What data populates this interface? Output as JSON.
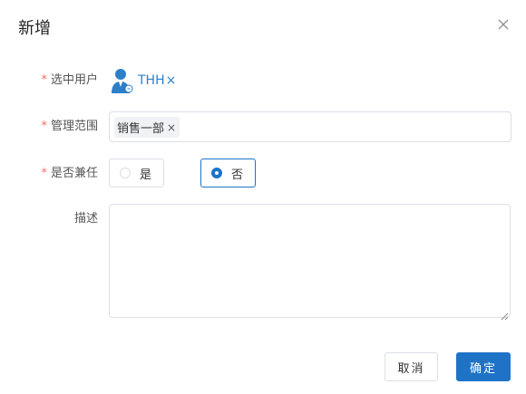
{
  "dialog": {
    "title": "新增"
  },
  "form": {
    "required_mark": "*",
    "selected_user": {
      "label": "选中用户",
      "value": "THH",
      "remove": "×"
    },
    "scope": {
      "label": "管理范围",
      "chips": [
        {
          "text": "销售一部",
          "remove": "×"
        }
      ]
    },
    "concurrent": {
      "label": "是否兼任",
      "options": [
        "是",
        "否"
      ],
      "selected": "否"
    },
    "description": {
      "label": "描述",
      "value": ""
    }
  },
  "footer": {
    "cancel": "取消",
    "confirm": "确定"
  },
  "colors": {
    "accent": "#1e73c7",
    "required": "#f56c6c"
  },
  "icons": {
    "close": "close-icon",
    "user": "user-avatar-icon"
  }
}
